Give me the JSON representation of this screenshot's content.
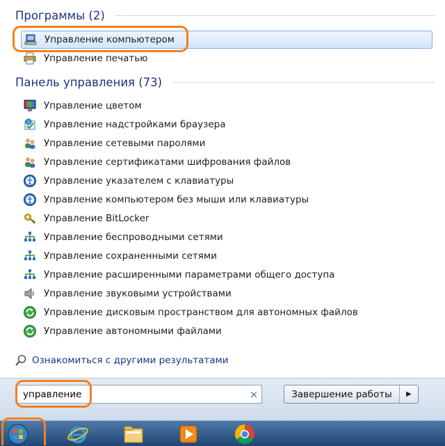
{
  "programs": {
    "header": "Программы (2)",
    "items": [
      {
        "label": "Управление компьютером",
        "icon": "computer-management-icon"
      },
      {
        "label": "Управление печатью",
        "icon": "printer-icon"
      }
    ]
  },
  "control_panel": {
    "header": "Панель управления (73)",
    "items": [
      {
        "label": "Управление цветом",
        "icon": "monitor-color-icon"
      },
      {
        "label": "Управление надстройками браузера",
        "icon": "browser-addons-icon"
      },
      {
        "label": "Управление сетевыми паролями",
        "icon": "users-icon"
      },
      {
        "label": "Управление сертификатами шифрования файлов",
        "icon": "users-icon"
      },
      {
        "label": "Управление указателем с клавиатуры",
        "icon": "ease-of-access-icon"
      },
      {
        "label": "Управление компьютером без мыши или клавиатуры",
        "icon": "ease-of-access-icon"
      },
      {
        "label": "Управление BitLocker",
        "icon": "bitlocker-key-icon"
      },
      {
        "label": "Управление беспроводными сетями",
        "icon": "network-icon"
      },
      {
        "label": "Управление сохраненными сетями",
        "icon": "network-icon"
      },
      {
        "label": "Управление расширенными параметрами общего доступа",
        "icon": "network-icon"
      },
      {
        "label": "Управление звуковыми устройствами",
        "icon": "speaker-icon"
      },
      {
        "label": "Управление дисковым пространством для автономных файлов",
        "icon": "sync-icon"
      },
      {
        "label": "Управление автономными файлами",
        "icon": "sync-icon"
      }
    ]
  },
  "more_results": {
    "label": "Ознакомиться с другими результатами",
    "icon": "search-icon"
  },
  "search": {
    "value": "управление",
    "clear_symbol": "×"
  },
  "shutdown": {
    "label": "Завершение работы",
    "arrow": "▶"
  },
  "taskbar": {
    "items": [
      "start-orb-icon",
      "internet-explorer-icon",
      "file-explorer-icon",
      "media-player-icon",
      "chrome-icon"
    ]
  },
  "colors": {
    "highlight": "#f57f1c",
    "header_text": "#1e3287",
    "taskbar": "#1f4672"
  }
}
